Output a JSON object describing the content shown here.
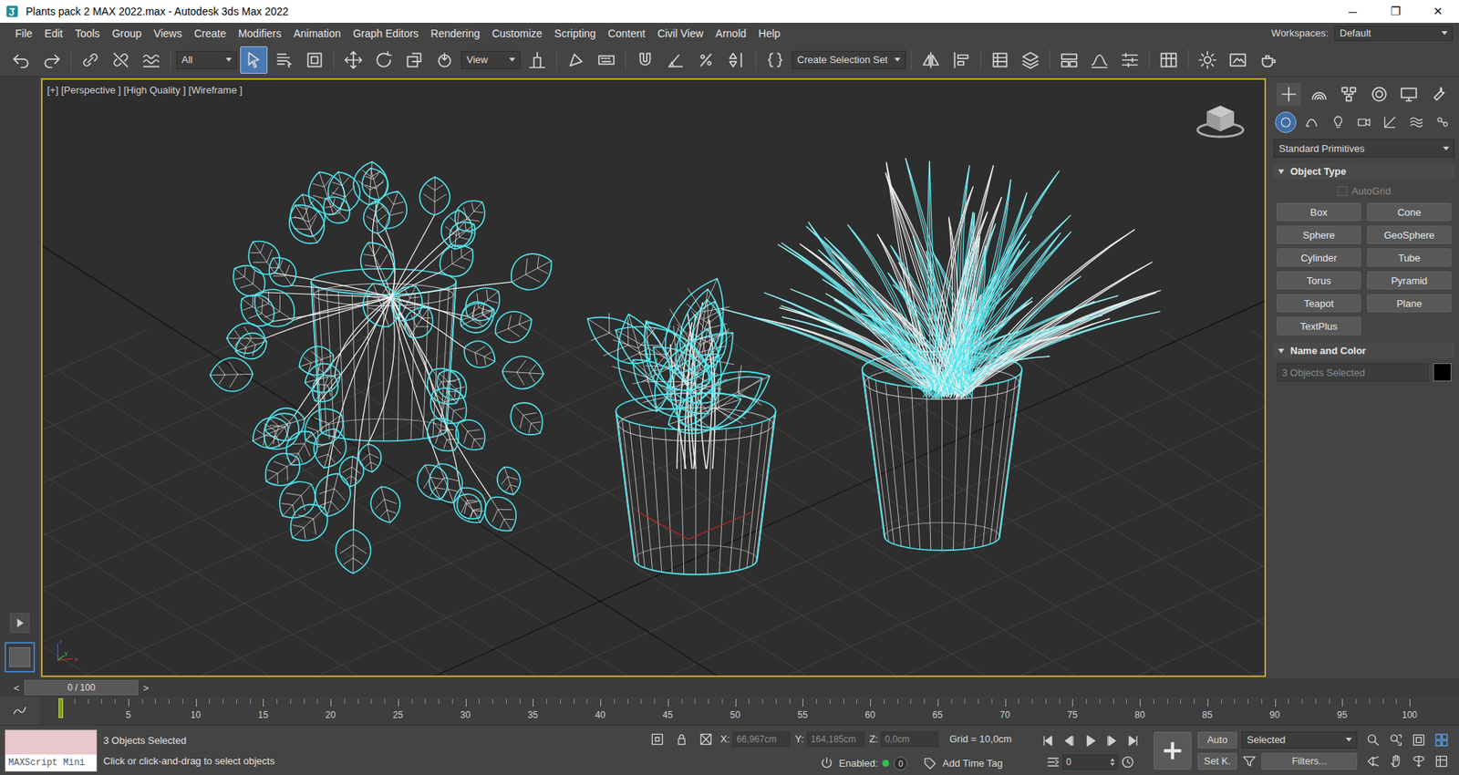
{
  "window": {
    "title": "Plants pack 2 MAX 2022.max - Autodesk 3ds Max 2022",
    "controls": [
      "─",
      "❐",
      "✕"
    ]
  },
  "menu": [
    "File",
    "Edit",
    "Tools",
    "Group",
    "Views",
    "Create",
    "Modifiers",
    "Animation",
    "Graph Editors",
    "Rendering",
    "Customize",
    "Scripting",
    "Content",
    "Civil View",
    "Arnold",
    "Help"
  ],
  "workspaces": {
    "label": "Workspaces:",
    "value": "Default"
  },
  "toolbar": {
    "selection_filter": "All",
    "reference_coordinate": "View",
    "selection_set": "Create Selection Set",
    "tools": [
      {
        "selected": false
      },
      {
        "selected": false
      },
      {
        "selected": false
      },
      {
        "selected": false
      },
      {
        "selected": false
      },
      {
        "selected": true
      },
      {
        "selected": false
      },
      {
        "selected": false
      },
      {
        "selected": false
      },
      {
        "selected": false
      },
      {
        "selected": false
      },
      {
        "selected": false
      },
      {
        "selected": false
      },
      {
        "selected": false
      },
      {
        "selected": false
      },
      {
        "selected": false
      },
      {
        "selected": false
      },
      {
        "selected": false
      },
      {
        "selected": false
      },
      {
        "selected": false
      },
      {
        "selected": false
      },
      {
        "selected": false
      },
      {
        "selected": false
      },
      {
        "selected": false
      },
      {
        "selected": false
      },
      {
        "selected": false
      },
      {
        "selected": false
      },
      {
        "selected": false
      },
      {
        "selected": false
      },
      {
        "selected": false
      },
      {
        "selected": false
      }
    ]
  },
  "viewport": {
    "label": "[+] [Perspective ] [High Quality ] [Wireframe ]",
    "active": true,
    "axis_labels": [
      "x",
      "y",
      "z"
    ]
  },
  "command_panel": {
    "tabs": [
      {
        "selected": true
      },
      {
        "selected": false
      },
      {
        "selected": false
      },
      {
        "selected": false
      },
      {
        "selected": false
      },
      {
        "selected": false
      }
    ],
    "categories": [
      {
        "selected": true
      },
      {
        "selected": false
      },
      {
        "selected": false
      },
      {
        "selected": false
      },
      {
        "selected": false
      },
      {
        "selected": false
      },
      {
        "selected": false
      }
    ],
    "dropdown": "Standard Primitives",
    "object_type": {
      "title": "Object Type",
      "expanded": true,
      "autogrid": {
        "label": "AutoGrid",
        "checked": false,
        "disabled": true
      },
      "buttons": [
        "Box",
        "Cone",
        "Sphere",
        "GeoSphere",
        "Cylinder",
        "Tube",
        "Torus",
        "Pyramid",
        "Teapot",
        "Plane",
        "TextPlus"
      ]
    },
    "name_and_color": {
      "title": "Name and Color",
      "expanded": true,
      "name_field": "3 Objects Selected",
      "color": "#000000"
    }
  },
  "timeline": {
    "slider": "0 / 100",
    "prev": "<",
    "next": ">",
    "level": 0,
    "ruler_labels": [
      "5",
      "10",
      "15",
      "20",
      "25",
      "30",
      "35",
      "40",
      "45",
      "50",
      "55",
      "60",
      "65",
      "70",
      "75",
      "80",
      "85",
      "90",
      "95",
      "100"
    ]
  },
  "status": {
    "maxscript": "MAXScript Mini",
    "selection": "3 Objects Selected",
    "prompt": "Click or click-and-drag to select objects",
    "coords": [
      {
        "label": "X:",
        "value": "66,967cm"
      },
      {
        "label": "Y:",
        "value": "164,185cm"
      },
      {
        "label": "Z:",
        "value": "0,0cm"
      }
    ],
    "grid": "Grid = 10,0cm",
    "enabled": {
      "label": "Enabled:",
      "on": true,
      "count": "0"
    },
    "time_tag": "Add Time Tag",
    "frame": "0",
    "auto_key": "Auto",
    "auto_key_on": false,
    "key_filter": "Selected",
    "set_key": "Set K.",
    "filters": "Filters..."
  }
}
